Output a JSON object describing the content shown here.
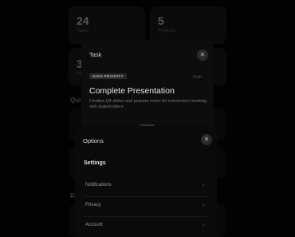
{
  "dashboard": {
    "stats": [
      {
        "value": "24",
        "label": "Tasks"
      },
      {
        "value": "5",
        "label": "Projects"
      },
      {
        "value": "3",
        "label": "Me"
      }
    ],
    "section_quick": "Quic",
    "section_recent": "Re"
  },
  "task_sheet": {
    "title": "Task",
    "close_icon": "close-icon",
    "badge": "HIGH PRIORITY",
    "status": "Draft",
    "heading": "Complete Presentation",
    "description": "Finalize Q4 slides and prepare notes for tomorrow's meeting with stakeholders."
  },
  "options_sheet": {
    "title": "Options",
    "section": "Settings",
    "items": [
      {
        "label": "Notifications",
        "icon": "chevron-right-icon"
      },
      {
        "label": "Privacy",
        "icon": "chevron-right-icon"
      },
      {
        "label": "Account",
        "icon": "chevron-right-icon"
      }
    ]
  }
}
